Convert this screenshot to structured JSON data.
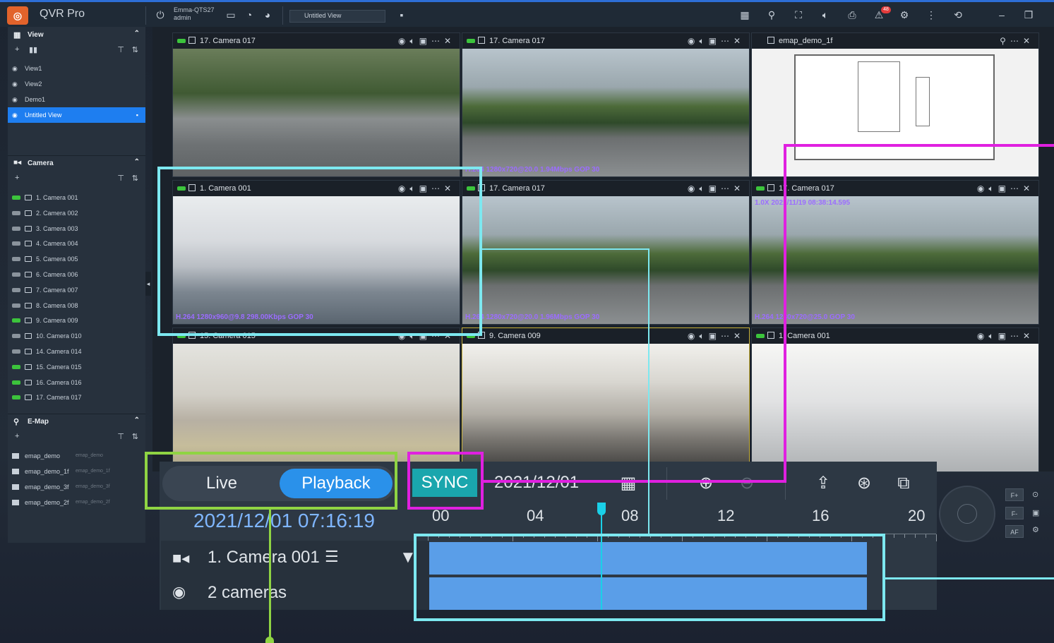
{
  "app": {
    "title": "QVR Pro",
    "logo_glyph": "◎"
  },
  "topbar": {
    "server_name": "Emma-QTS27",
    "user": "admin",
    "view_select": "Untitled View",
    "badge_count": "48"
  },
  "sidebar": {
    "view_header": "View",
    "views": [
      {
        "label": "View1"
      },
      {
        "label": "View2"
      },
      {
        "label": "Demo1"
      },
      {
        "label": "Untitled View",
        "selected": true
      }
    ],
    "camera_header": "Camera",
    "cameras": [
      {
        "label": "1. Camera 001",
        "status": "on"
      },
      {
        "label": "2. Camera 002",
        "status": "off"
      },
      {
        "label": "3. Camera 003",
        "status": "off"
      },
      {
        "label": "4. Camera 004",
        "status": "off"
      },
      {
        "label": "5. Camera 005",
        "status": "off"
      },
      {
        "label": "6. Camera 006",
        "status": "off"
      },
      {
        "label": "7. Camera 007",
        "status": "off"
      },
      {
        "label": "8. Camera 008",
        "status": "off"
      },
      {
        "label": "9. Camera 009",
        "status": "on"
      },
      {
        "label": "10. Camera 010",
        "status": "off"
      },
      {
        "label": "14. Camera 014",
        "status": "off"
      },
      {
        "label": "15. Camera 015",
        "status": "on"
      },
      {
        "label": "16. Camera 016",
        "status": "on"
      },
      {
        "label": "17. Camera 017",
        "status": "on"
      }
    ],
    "emap_header": "E-Map",
    "emaps": [
      {
        "label": "emap_demo",
        "sub": "emap_demo"
      },
      {
        "label": "emap_demo_1f",
        "sub": "emap_demo_1f"
      },
      {
        "label": "emap_demo_3f",
        "sub": "emap_demo_3f"
      },
      {
        "label": "emap_demo_2f",
        "sub": "emap_demo_2f"
      }
    ]
  },
  "tiles": [
    {
      "title": "17. Camera 017",
      "overlay": ""
    },
    {
      "title": "17. Camera 017",
      "overlay": "H.264 1280x720@20.0 1.94Mbps GOP 30"
    },
    {
      "title": "emap_demo_1f",
      "overlay": ""
    },
    {
      "title": "1. Camera 001",
      "overlay": "H.264 1280x960@9.8 298.00Kbps GOP 30"
    },
    {
      "title": "17. Camera 017",
      "overlay": "H.264 1280x720@20.0 1.96Mbps GOP 30"
    },
    {
      "title": "17. Camera 017",
      "overlay": "H.264 1280x720@25.0 GOP 30",
      "timestamp": "1.0X 2021/11/19 08:38:14.595"
    },
    {
      "title": "15. Camera 015",
      "overlay": ""
    },
    {
      "title": "9. Camera 009",
      "overlay": ""
    },
    {
      "title": "1. Camera 001",
      "overlay": ""
    }
  ],
  "playback": {
    "live_label": "Live",
    "playback_label": "Playback",
    "sync_label": "SYNC",
    "date": "2021/12/01",
    "datetime": "2021/12/01 07:16:19",
    "hours": [
      "00",
      "04",
      "08",
      "12",
      "16",
      "20"
    ],
    "current_time_fraction": 0.3,
    "row_camera": "1. Camera 001",
    "row_summary": "2 cameras"
  },
  "ptz": {
    "buttons": [
      "F+",
      "F-",
      "AF"
    ]
  },
  "colors": {
    "accent": "#2a91ea",
    "sync": "#1aa6ad",
    "annot_cyan": "#1ad0e8",
    "annot_magenta": "#e020e0",
    "annot_green": "#8fd443",
    "timeline": "#5a9ee8"
  }
}
